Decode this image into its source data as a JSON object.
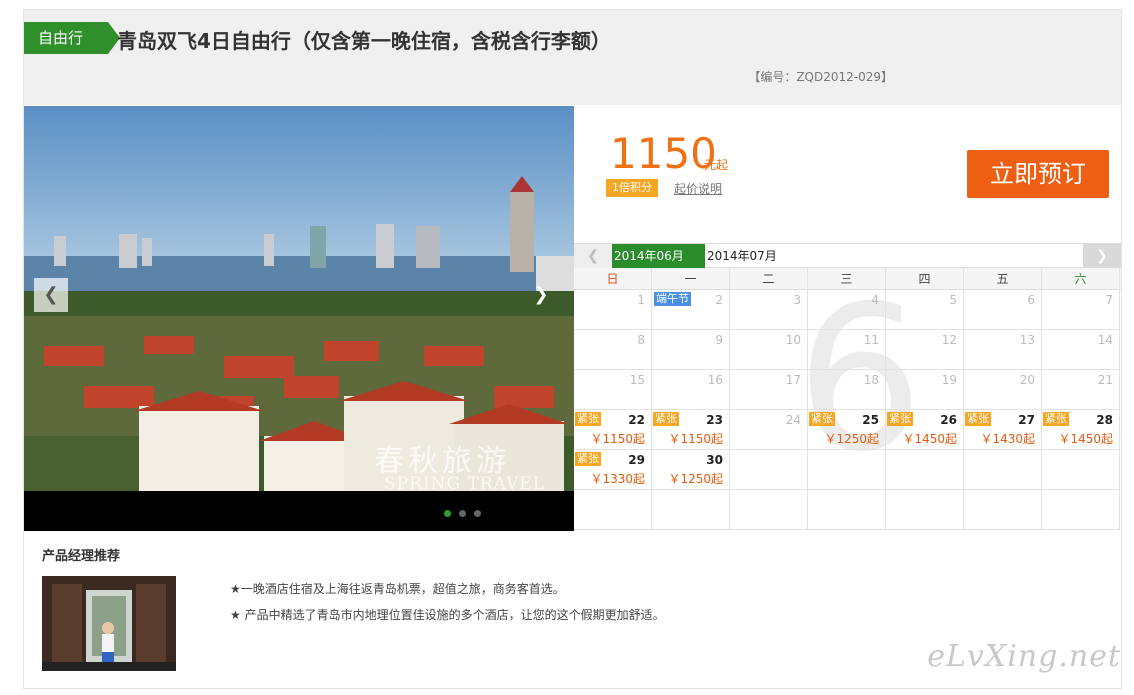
{
  "header": {
    "tag": "自由行",
    "title": "青岛双飞4日自由行（仅含第一晚住宿，含税含行李额）",
    "code": "【编号：ZQD2012-029】"
  },
  "photo": {
    "watermark_cn": "春秋旅游",
    "watermark_en": "SPRING TRAVEL",
    "prev_icon": "chevron-left-icon",
    "next_icon": "chevron-right-icon"
  },
  "pricing": {
    "price": "1150",
    "unit": "元起",
    "points": "1倍积分",
    "points_link": "起价说明",
    "book": "立即预订"
  },
  "calendar": {
    "current_month": "2014年06月",
    "next_month": "2014年07月",
    "watermark_month": "6",
    "weekdays": [
      "日",
      "一",
      "二",
      "三",
      "四",
      "五",
      "六"
    ],
    "holiday_label": "端午节",
    "badge_label": "紧张",
    "rows": [
      [
        {
          "d": "1"
        },
        {
          "d": "2",
          "holiday": true
        },
        {
          "d": "3"
        },
        {
          "d": "4"
        },
        {
          "d": "5"
        },
        {
          "d": "6"
        },
        {
          "d": "7"
        }
      ],
      [
        {
          "d": "8"
        },
        {
          "d": "9"
        },
        {
          "d": "10"
        },
        {
          "d": "11"
        },
        {
          "d": "12"
        },
        {
          "d": "13"
        },
        {
          "d": "14"
        }
      ],
      [
        {
          "d": "15"
        },
        {
          "d": "16"
        },
        {
          "d": "17"
        },
        {
          "d": "18"
        },
        {
          "d": "19"
        },
        {
          "d": "20"
        },
        {
          "d": "21"
        }
      ],
      [
        {
          "d": "22",
          "p": "￥1150起"
        },
        {
          "d": "23",
          "p": "￥1150起"
        },
        {
          "d": "24"
        },
        {
          "d": "25",
          "p": "￥1250起"
        },
        {
          "d": "26",
          "p": "￥1450起"
        },
        {
          "d": "27",
          "p": "￥1430起"
        },
        {
          "d": "28",
          "p": "￥1450起"
        }
      ],
      [
        {
          "d": "29",
          "p": "￥1330起"
        },
        {
          "d": "30",
          "p": "￥1250起",
          "nobadge": true
        },
        {
          "d": ""
        },
        {
          "d": ""
        },
        {
          "d": ""
        },
        {
          "d": ""
        },
        {
          "d": ""
        }
      ],
      [
        {
          "d": ""
        },
        {
          "d": ""
        },
        {
          "d": ""
        },
        {
          "d": ""
        },
        {
          "d": ""
        },
        {
          "d": ""
        },
        {
          "d": ""
        }
      ]
    ]
  },
  "recommend": {
    "title": "产品经理推荐",
    "lines": [
      "★一晚酒店住宿及上海往返青岛机票，超值之旅，商务客首选。",
      "★ 产品中精选了青岛市内地理位置佳设施的多个酒店，让您的这个假期更加舒适。"
    ]
  },
  "site_watermark": "eLvXing.net"
}
